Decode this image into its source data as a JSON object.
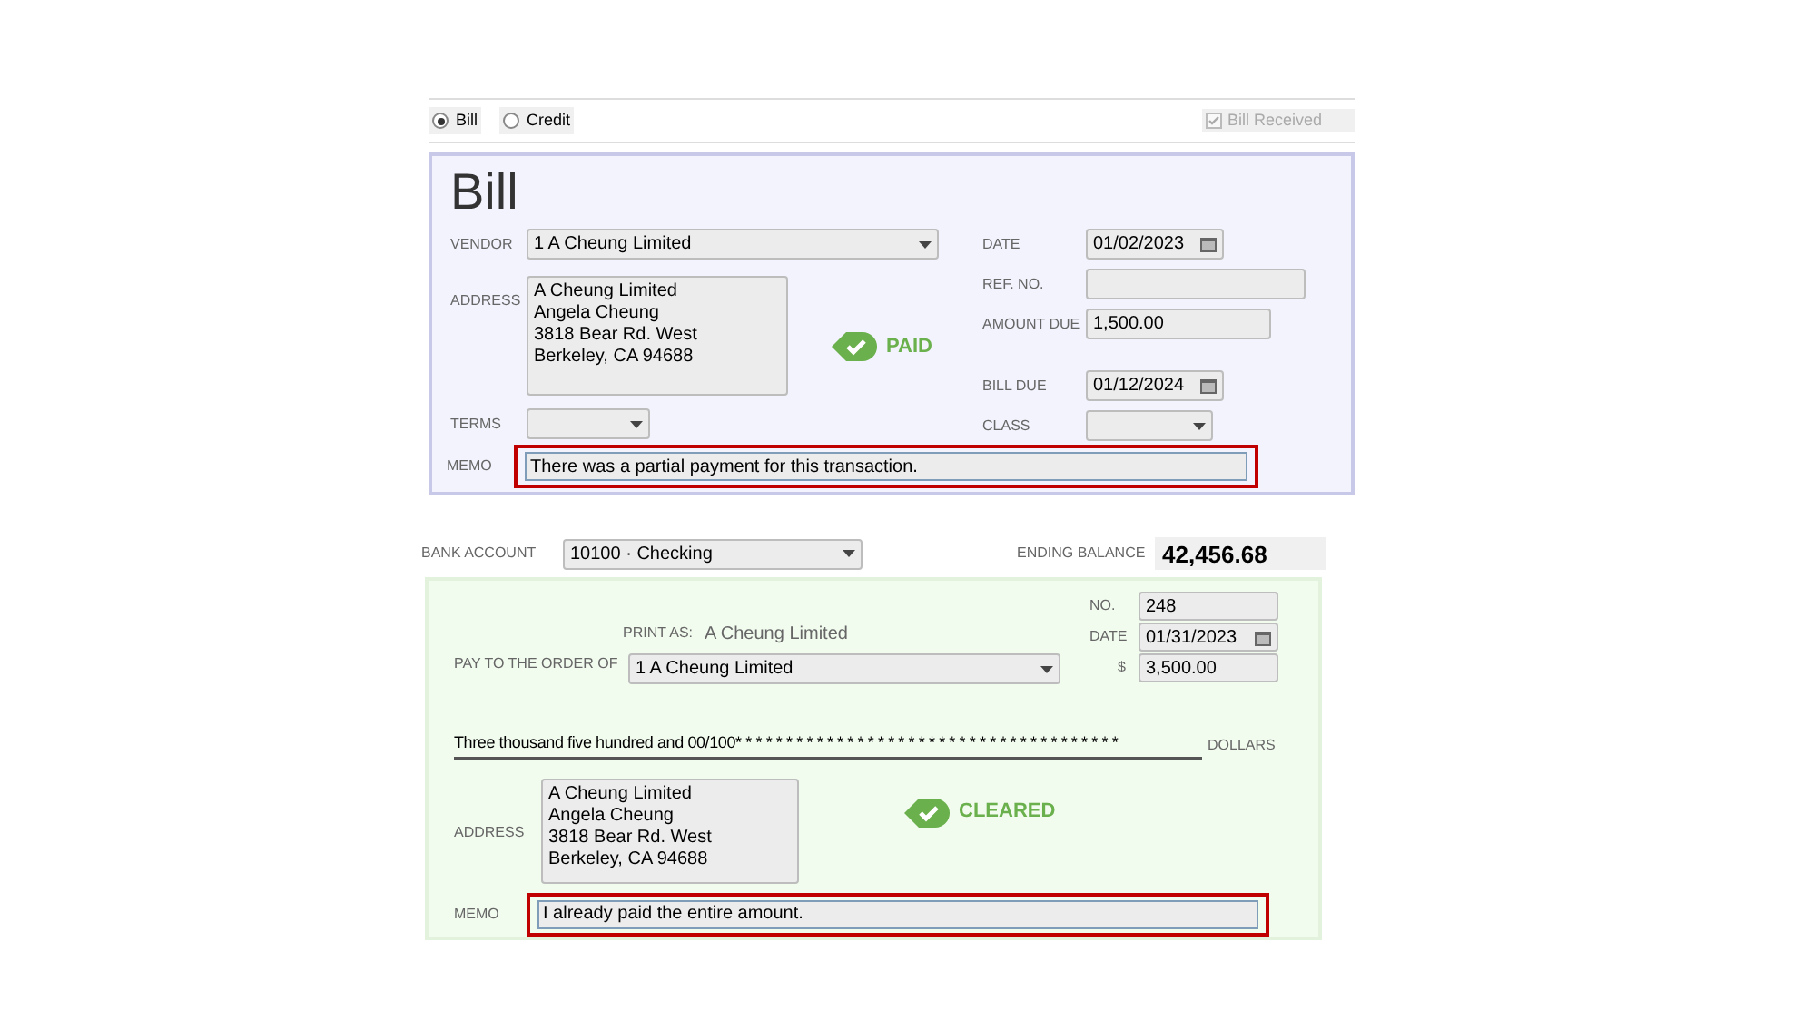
{
  "bill_type": [
    {
      "label": "Bill",
      "selected": true
    },
    {
      "label": "Credit",
      "selected": false
    }
  ],
  "bill_received": {
    "label": "Bill Received",
    "checked": true,
    "disabled": true
  },
  "bill": {
    "title": "Bill",
    "vendor": {
      "label": "VENDOR",
      "value": "1 A Cheung Limited"
    },
    "address": {
      "label": "ADDRESS",
      "lines": [
        "A Cheung Limited",
        "Angela Cheung",
        "3818 Bear Rd. West",
        "Berkeley, CA 94688"
      ]
    },
    "stamp": "PAID",
    "terms": {
      "label": "TERMS"
    },
    "date": {
      "label": "DATE",
      "value": "01/02/2023"
    },
    "ref_no": {
      "label": "REF. NO."
    },
    "amount_due": {
      "label": "AMOUNT DUE",
      "value": "1,500.00"
    },
    "bill_due": {
      "label": "BILL DUE",
      "value": "01/12/2024"
    },
    "class": {
      "label": "CLASS"
    },
    "memo": {
      "label": "MEMO",
      "value": "There was a partial payment for this transaction.",
      "highlighted": true
    }
  },
  "bank_account": {
    "label": "BANK ACCOUNT",
    "value": "10100 · Checking"
  },
  "ending_balance": {
    "label": "ENDING BALANCE",
    "value": "42,456.68"
  },
  "check": {
    "no": {
      "label": "NO.",
      "value": "248"
    },
    "date": {
      "label": "DATE",
      "value": "01/31/2023"
    },
    "print_as": {
      "label": "PRINT AS:",
      "value": "A Cheung Limited"
    },
    "pay_to": {
      "label": "PAY TO THE ORDER OF",
      "value": "1 A Cheung Limited"
    },
    "amount": {
      "label": "$",
      "value": "3,500.00"
    },
    "amount_words": "Three thousand five hundred and 00/100* * * * * * * * * * * * * * * * * * * * * * * * * * * * * * * * * * * * * *",
    "dollars": "DOLLARS",
    "address": {
      "label": "ADDRESS",
      "lines": [
        "A Cheung Limited",
        "Angela Cheung",
        "3818 Bear Rd. West",
        "Berkeley, CA 94688"
      ]
    },
    "stamp": "CLEARED",
    "memo": {
      "label": "MEMO",
      "value": "I already paid the entire amount.",
      "highlighted": true
    }
  }
}
